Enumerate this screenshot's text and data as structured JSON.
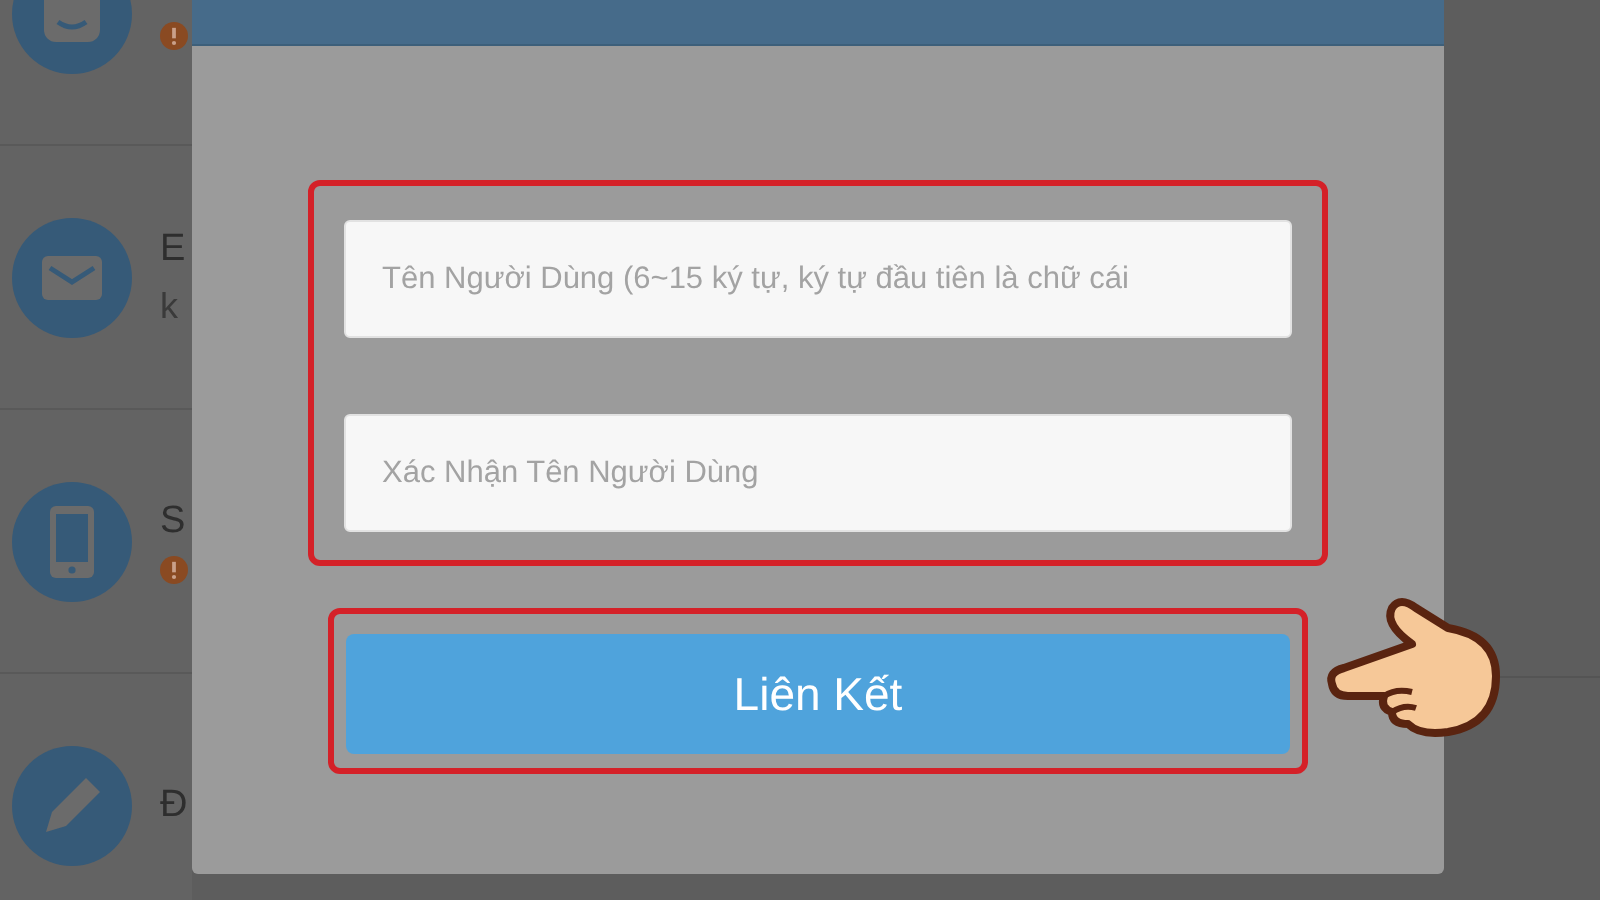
{
  "background_list": [
    {
      "kind": "face",
      "warning": true
    },
    {
      "kind": "mail",
      "title": "E",
      "subtitle": "k",
      "warning": false
    },
    {
      "kind": "phone",
      "title": "S",
      "warning": true
    },
    {
      "kind": "pencil",
      "title": "Đ",
      "warning": false
    }
  ],
  "dialog": {
    "fields": [
      {
        "placeholder": "Tên Người Dùng (6~15 ký tự, ký tự đầu tiên là chữ cái"
      },
      {
        "placeholder": "Xác Nhận Tên Người Dùng"
      }
    ],
    "button": "Liên Kết"
  }
}
